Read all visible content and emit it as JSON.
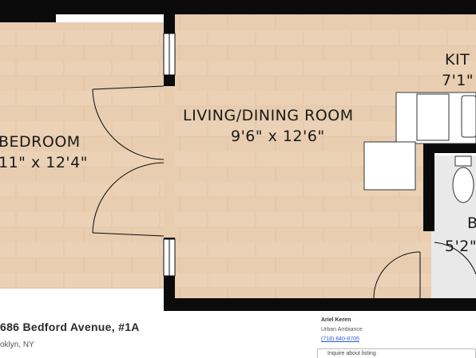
{
  "floorplan": {
    "rooms": [
      {
        "name": "BEDROOM",
        "dimensions": "11\" x 12'4\""
      },
      {
        "name": "LIVING/DINING ROOM",
        "dimensions": "9'6\" x 12'6\""
      },
      {
        "name": "KIT",
        "dimensions": "7'1\""
      },
      {
        "name": "B",
        "dimensions": "5'2\""
      }
    ],
    "colors": {
      "wall": "#0b0b0b",
      "floor": "#e8cdb0",
      "floor_grain": "#d9b895",
      "tile": "#e9e9e9"
    }
  },
  "listing": {
    "address": "686 Bedford Avenue, #1A",
    "city": "oklyn, NY"
  },
  "agent": {
    "name": "Ariel Keren",
    "company": "Urban Ambiance",
    "phone": "(718) 840-8705",
    "inquire_label": "Inquire about listing"
  }
}
